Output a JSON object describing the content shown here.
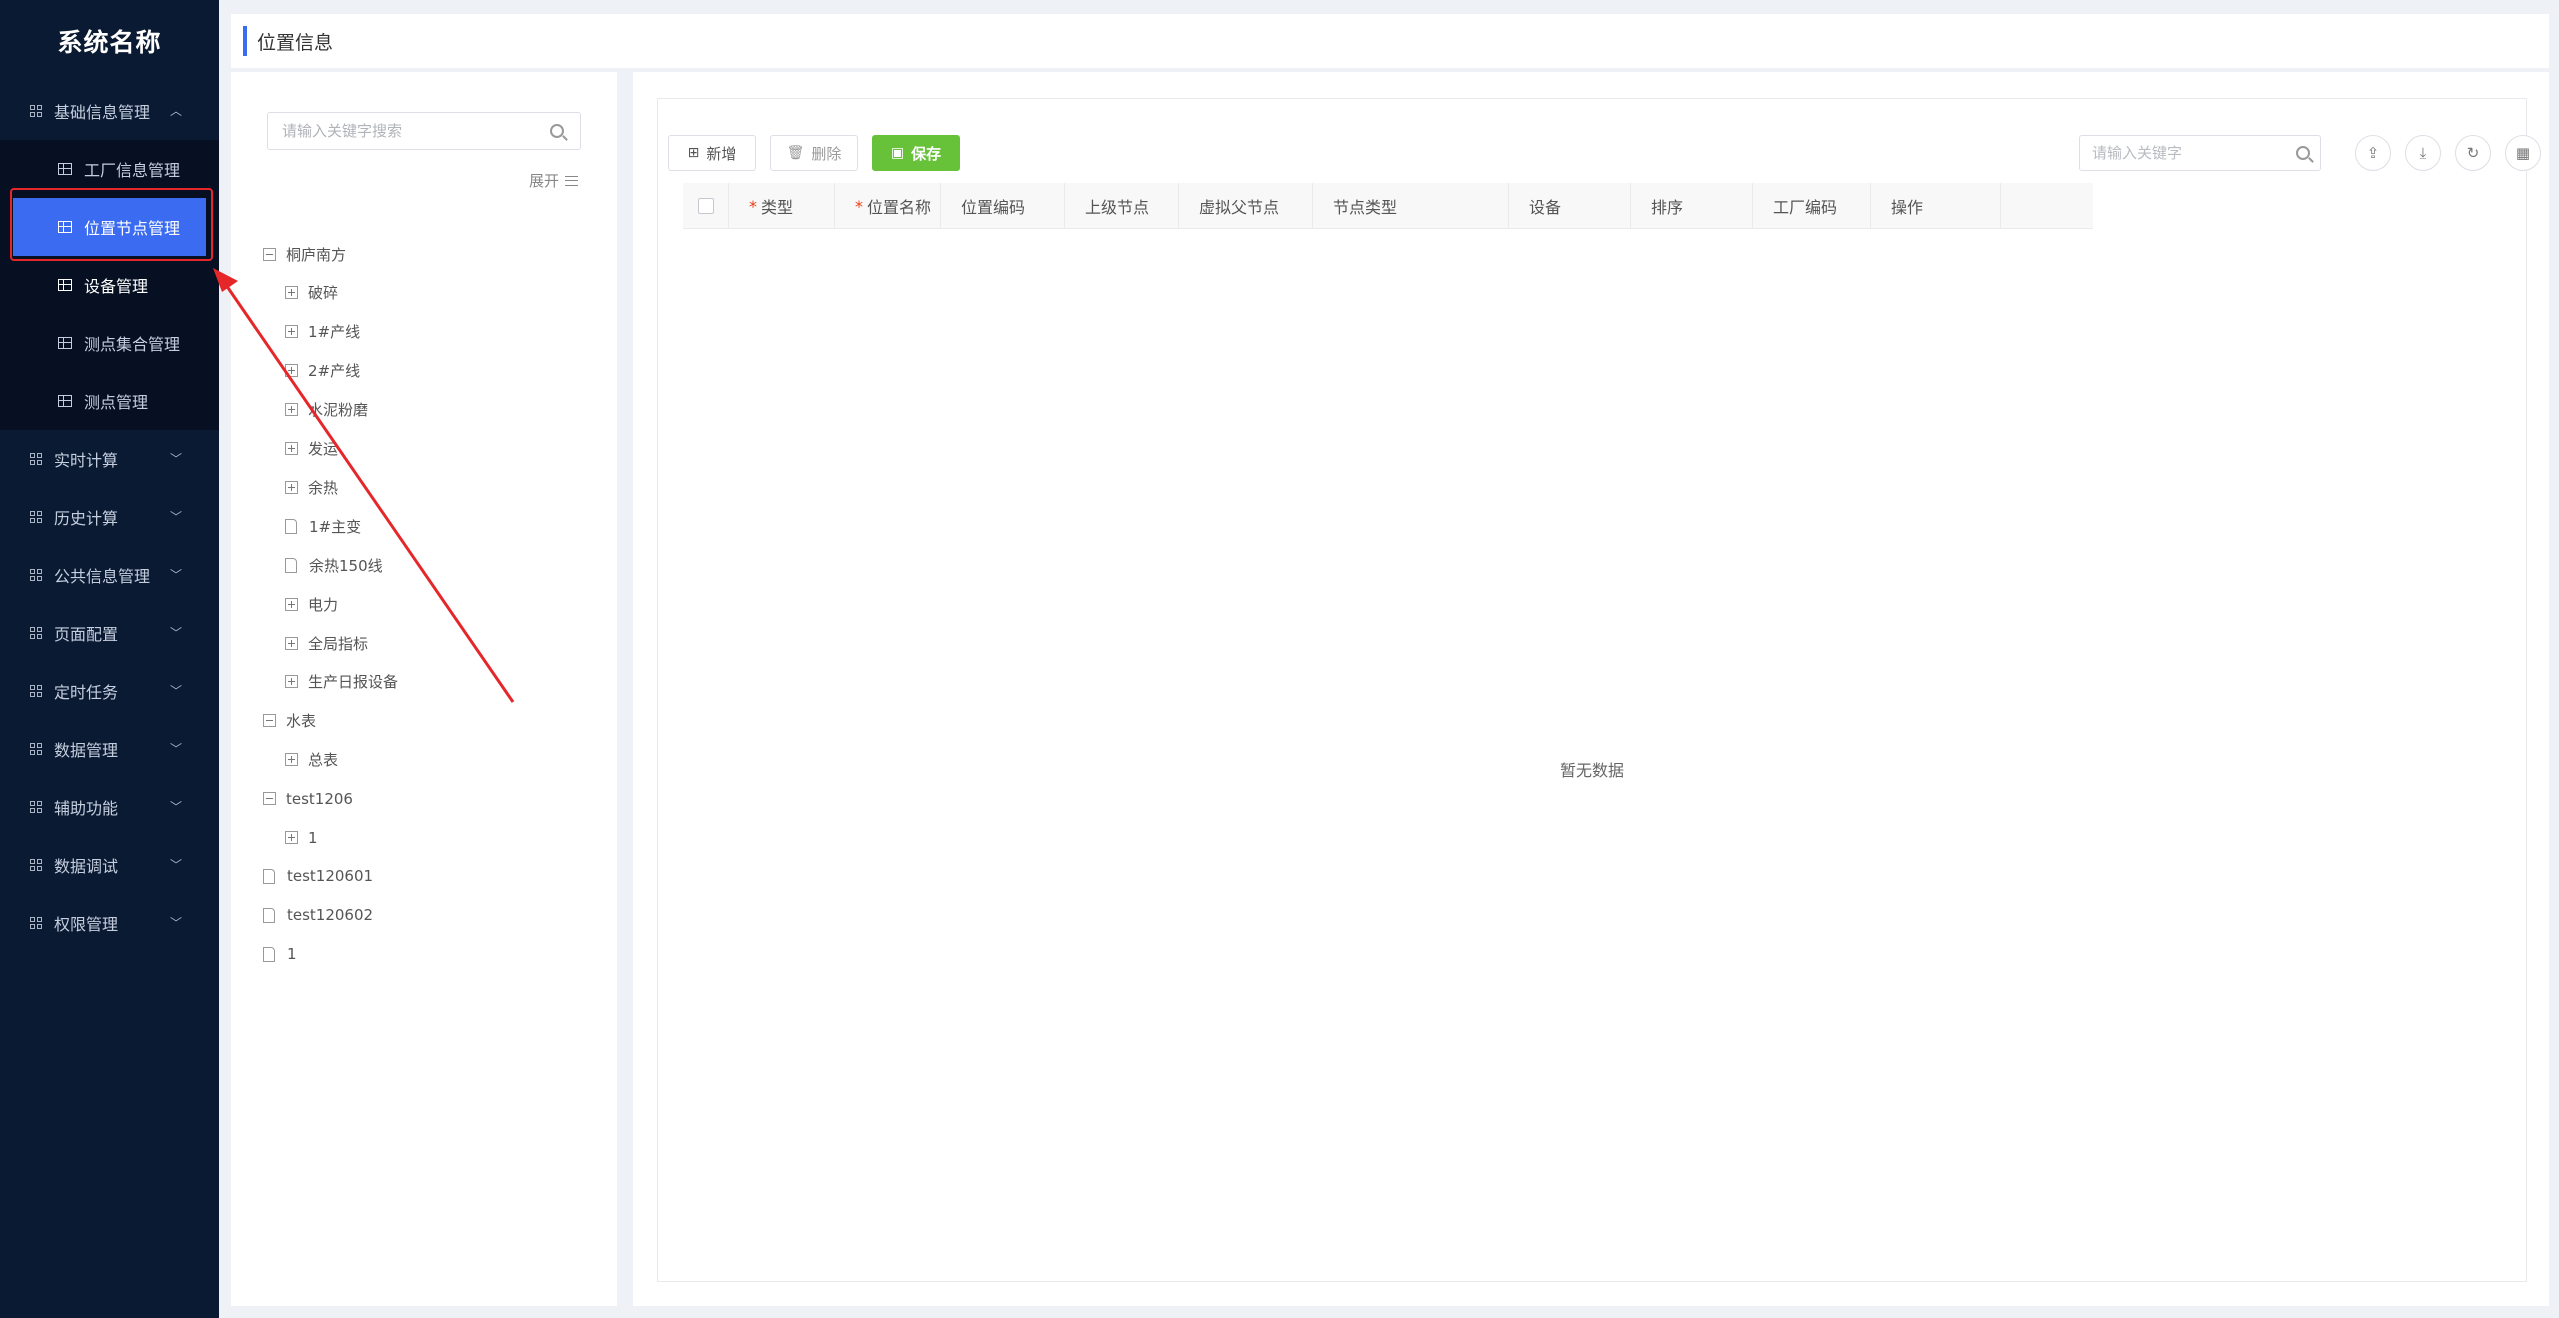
{
  "app": {
    "title": "系统名称"
  },
  "sidebar": {
    "groups": [
      {
        "label": "基础信息管理",
        "expanded": true
      },
      {
        "label": "实时计算"
      },
      {
        "label": "历史计算"
      },
      {
        "label": "公共信息管理"
      },
      {
        "label": "页面配置"
      },
      {
        "label": "定时任务"
      },
      {
        "label": "数据管理"
      },
      {
        "label": "辅助功能"
      },
      {
        "label": "数据调试"
      },
      {
        "label": "权限管理"
      }
    ],
    "sub_items": [
      {
        "label": "工厂信息管理"
      },
      {
        "label": "位置节点管理",
        "active": true
      },
      {
        "label": "设备管理"
      },
      {
        "label": "测点集合管理"
      },
      {
        "label": "测点管理"
      }
    ]
  },
  "header": {
    "title": "位置信息"
  },
  "tree": {
    "search_placeholder": "请输入关键字搜索",
    "expand_label": "展开",
    "nodes": [
      {
        "label": "桐庐南方",
        "level": 0,
        "type": "minus"
      },
      {
        "label": "破碎",
        "level": 1,
        "type": "plus"
      },
      {
        "label": "1#产线",
        "level": 1,
        "type": "plus"
      },
      {
        "label": "2#产线",
        "level": 1,
        "type": "plus"
      },
      {
        "label": "水泥粉磨",
        "level": 1,
        "type": "plus"
      },
      {
        "label": "发运",
        "level": 1,
        "type": "plus"
      },
      {
        "label": "余热",
        "level": 1,
        "type": "plus"
      },
      {
        "label": "1#主变",
        "level": 1,
        "type": "file"
      },
      {
        "label": "余热150线",
        "level": 1,
        "type": "file"
      },
      {
        "label": "电力",
        "level": 1,
        "type": "plus"
      },
      {
        "label": "全局指标",
        "level": 1,
        "type": "plus"
      },
      {
        "label": "生产日报设备",
        "level": 1,
        "type": "plus"
      },
      {
        "label": "水表",
        "level": 0,
        "type": "minus"
      },
      {
        "label": "总表",
        "level": 1,
        "type": "plus"
      },
      {
        "label": "test1206",
        "level": 0,
        "type": "minus"
      },
      {
        "label": "1",
        "level": 1,
        "type": "plus"
      },
      {
        "label": "test120601",
        "level": 0,
        "type": "file"
      },
      {
        "label": "test120602",
        "level": 0,
        "type": "file"
      },
      {
        "label": "1",
        "level": 0,
        "type": "file"
      }
    ]
  },
  "toolbar": {
    "add_label": "新增",
    "delete_label": "删除",
    "save_label": "保存",
    "search_placeholder": "请输入关键字"
  },
  "table": {
    "columns": [
      {
        "label": "类型",
        "required": true
      },
      {
        "label": "位置名称",
        "required": true
      },
      {
        "label": "位置编码"
      },
      {
        "label": "上级节点"
      },
      {
        "label": "虚拟父节点"
      },
      {
        "label": "节点类型"
      },
      {
        "label": "设备"
      },
      {
        "label": "排序"
      },
      {
        "label": "工厂编码"
      },
      {
        "label": "操作"
      }
    ],
    "empty_text": "暂无数据"
  },
  "colors": {
    "sidebar_bg": "#0b1a33",
    "active_item": "#3a6bf0",
    "save_button": "#67c23a",
    "annotation": "#e5272a"
  }
}
